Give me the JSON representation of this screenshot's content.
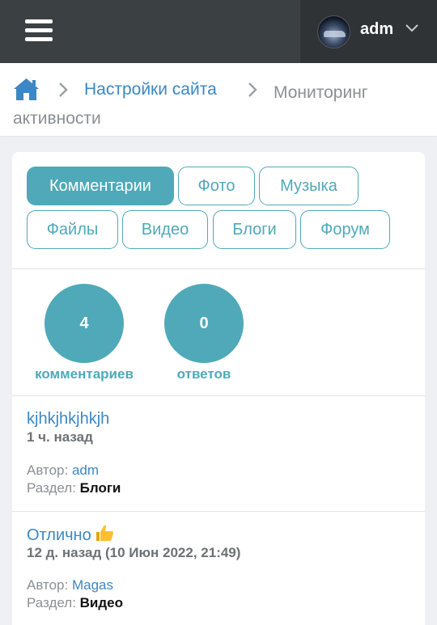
{
  "topbar": {
    "menu_icon": "hamburger-icon",
    "user_name": "adm",
    "dropdown_icon": "chevron-down-icon"
  },
  "breadcrumb": {
    "home_icon": "home-icon",
    "separator_icon": "chevron-right-icon",
    "link_label": "Настройки сайта",
    "current_label": "Мониторинг активности"
  },
  "tabs": [
    {
      "label": "Комментарии",
      "active": true
    },
    {
      "label": "Фото",
      "active": false
    },
    {
      "label": "Музыка",
      "active": false
    },
    {
      "label": "Файлы",
      "active": false
    },
    {
      "label": "Видео",
      "active": false
    },
    {
      "label": "Блоги",
      "active": false
    },
    {
      "label": "Форум",
      "active": false
    }
  ],
  "stats": [
    {
      "value": "4",
      "label": "комментариев"
    },
    {
      "value": "0",
      "label": "ответов"
    }
  ],
  "items": [
    {
      "title": "kjhkjhkjhkjh",
      "emoji_icon": "",
      "time": "1 ч. назад",
      "author_label": "Автор:",
      "author": "adm",
      "section_label": "Раздел:",
      "section": "Блоги"
    },
    {
      "title": "Отлично",
      "emoji_icon": "thumbs-up-icon",
      "time": "12 д. назад (10 Июн 2022, 21:49)",
      "author_label": "Автор:",
      "author": "Magas",
      "section_label": "Раздел:",
      "section": "Видео"
    }
  ],
  "colors": {
    "accent": "#4fa9b8",
    "link": "#3d87c4",
    "topbar": "#3b4043"
  }
}
